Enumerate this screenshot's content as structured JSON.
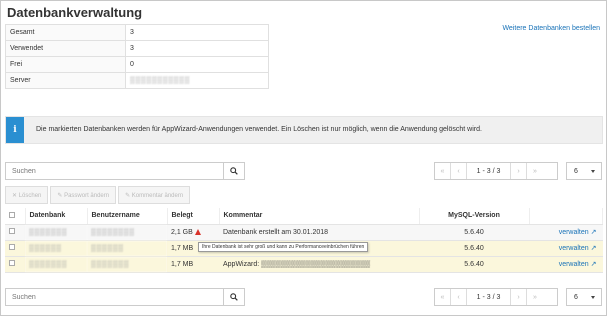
{
  "page": {
    "title": "Datenbankverwaltung",
    "order_link": "Weitere Datenbanken bestellen"
  },
  "summary": [
    {
      "label": "Gesamt",
      "value": "3"
    },
    {
      "label": "Verwendet",
      "value": "3"
    },
    {
      "label": "Frei",
      "value": "0"
    },
    {
      "label": "Server",
      "value": "blurred"
    }
  ],
  "info": {
    "icon": "i",
    "message": "Die markierten Datenbanken werden für AppWizard-Anwendungen verwendet. Ein Löschen ist nur möglich, wenn die Anwendung gelöscht wird."
  },
  "search": {
    "placeholder": "Suchen"
  },
  "pagination": {
    "first": "«",
    "prev": "‹",
    "range": "1 - 3 / 3",
    "next": "›",
    "last": "»"
  },
  "per_page": "6",
  "actions": {
    "delete": "✕ Löschen",
    "password": "✎ Passwort ändern",
    "comment": "✎ Kommentar ändern"
  },
  "table": {
    "headers": {
      "db": "Datenbank",
      "user": "Benutzername",
      "used": "Belegt",
      "comment": "Kommentar",
      "mysql": "MySQL-Version"
    },
    "rows": [
      {
        "db": "▒▒▒▒▒▒▒",
        "user": "▒▒▒▒▒▒▒▒",
        "used": "2,1 GB",
        "comment": "Datenbank erstellt am 30.01.2018",
        "version": "5.6.40",
        "action": "verwalten"
      },
      {
        "db": "▒▒▒▒▒▒",
        "user": "▒▒▒▒▒▒",
        "used": "1,7 MB",
        "comment": "AppWizard: ▒▒▒▒▒▒▒▒▒▒▒▒▒▒▒▒",
        "version": "5.6.40",
        "action": "verwalten"
      },
      {
        "db": "▒▒▒▒▒▒▒",
        "user": "▒▒▒▒▒▒▒",
        "used": "1,7 MB",
        "comment": "AppWizard: ▒▒▒▒▒▒▒▒▒▒▒▒▒▒▒▒▒▒▒▒▒▒",
        "version": "5.6.40",
        "action": "verwalten"
      }
    ]
  },
  "tooltip": "Ihre Datenbank ist sehr groß und kann zu Performanceeinbrüchen führen",
  "colors": {
    "link": "#1a73b8",
    "info_icon_bg": "#2a8fd1",
    "warning": "#d9332b",
    "highlight_row": "#fbf7dc"
  }
}
